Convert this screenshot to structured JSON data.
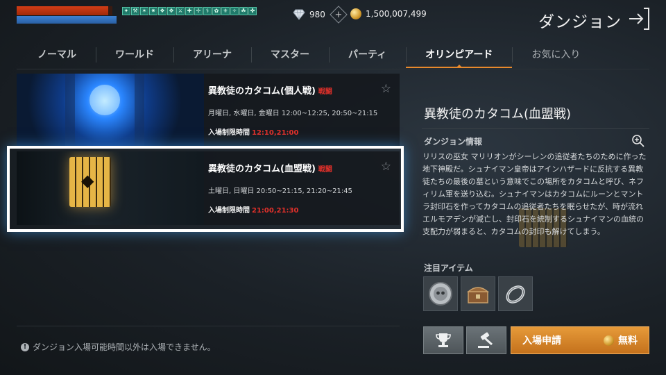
{
  "status": {
    "hp_fraction": 0.96,
    "mp_fraction": 1.0
  },
  "buffs": [
    "✦",
    "⚒",
    "✶",
    "✷",
    "❖",
    "✥",
    "⚔",
    "✚",
    "✢",
    "⚕",
    "✿",
    "⚜",
    "✧",
    "☘",
    "✤"
  ],
  "currency": {
    "diamonds": "980",
    "gold": "1,500,007,499",
    "diamond_icon": "diamond-icon",
    "gold_icon": "gold-coin-icon"
  },
  "header": {
    "title": "ダンジョン",
    "exit_icon": "exit-icon"
  },
  "tabs": [
    {
      "label": "ノーマル"
    },
    {
      "label": "ワールド"
    },
    {
      "label": "アリーナ"
    },
    {
      "label": "マスター"
    },
    {
      "label": "パーティ"
    },
    {
      "label": "オリンピアード",
      "active": true
    },
    {
      "label": "お気に入り"
    }
  ],
  "dungeons": [
    {
      "name": "異教徒のカタコム(個人戦)",
      "tag": "戦闘",
      "schedule": "月曜日, 水曜日, 金曜日  12:00~12:25, 20:50~21:15",
      "limit_label": "入場制限時間",
      "limit_times": "12:10,21:00"
    },
    {
      "name": "異教徒のカタコム(血盟戦)",
      "tag": "戦闘",
      "schedule": "土曜日, 日曜日  20:50~21:15, 21:20~21:45",
      "limit_label": "入場制限時間",
      "limit_times": "21:00,21:30",
      "selected": true
    }
  ],
  "notice": "ダンジョン入場可能時間以外は入場できません。",
  "detail": {
    "title": "異教徒のカタコム(血盟戦)",
    "info_label": "ダンジョン情報",
    "description": "リリスの巫女 マリリオンがシーレンの追従者たちのために作った地下神殿だ。シュナイマン皇帝はアインハザードに反抗する異教徒たちの最後の墓という意味でこの場所をカタコムと呼び、ネフィリム軍を送り込む。シュナイマンはカタコムにルーンとマントラ封印石を作ってカタコムの追従者たちを眠らせたが、時が流れエルモアデンが滅亡し、封印石を統制するシュナイマンの血統の支配力が弱まると、カタコムの封印も解けてしまう。",
    "items_label": "注目アイテム",
    "items": [
      "skull-coin-icon",
      "treasure-chest-icon",
      "bracelet-icon"
    ]
  },
  "buttons": {
    "rank_icon": "trophy-icon",
    "auction_icon": "auction-hammer-icon",
    "enter_label": "入場申請",
    "fee_label": "無料"
  },
  "colors": {
    "accent": "#e8892c",
    "battle_red": "#e0302a",
    "enter_button": "#d8862c"
  }
}
